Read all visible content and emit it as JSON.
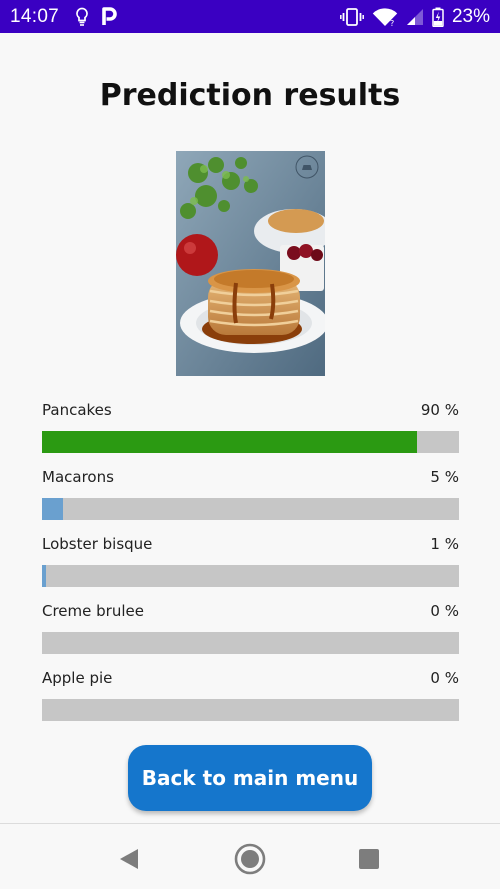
{
  "status_bar": {
    "time": "14:07",
    "battery_percent": "23%",
    "icons": [
      "lightbulb-icon",
      "parking-icon",
      "vibrate-icon",
      "wifi-icon",
      "signal-icon",
      "battery-charging-icon"
    ]
  },
  "page": {
    "title": "Prediction results"
  },
  "photo": {
    "subject": "stack of pancakes with syrup, raspberries and a red apple"
  },
  "results": [
    {
      "label": "Pancakes",
      "percent_text": "90 %",
      "value": 0.9,
      "color": "#2b9a12"
    },
    {
      "label": "Macarons",
      "percent_text": "5 %",
      "value": 0.05,
      "color": "#6aa0cf"
    },
    {
      "label": "Lobster bisque",
      "percent_text": "1 %",
      "value": 0.01,
      "color": "#6aa0cf"
    },
    {
      "label": "Creme brulee",
      "percent_text": "0 %",
      "value": 0.0,
      "color": "#6aa0cf"
    },
    {
      "label": "Apple pie",
      "percent_text": "0 %",
      "value": 0.0,
      "color": "#6aa0cf"
    }
  ],
  "actions": {
    "back_label": "Back to main menu"
  },
  "colors": {
    "status_bar": "#3a00c2",
    "primary_button": "#1576cc",
    "top_bar_fill": "#2b9a12",
    "other_bar_fill": "#6aa0cf",
    "bar_track": "#c6c6c6"
  },
  "nav_bar": {
    "icons": [
      "back-icon",
      "home-icon",
      "recents-icon"
    ]
  }
}
